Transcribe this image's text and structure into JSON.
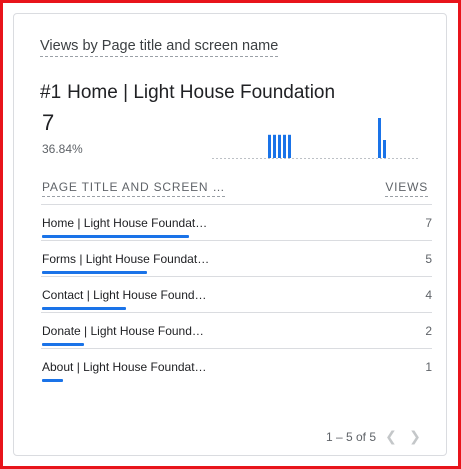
{
  "card": {
    "title": "Views by Page title and screen name"
  },
  "top": {
    "rank": "#1",
    "label": "Home | Light House Foundation",
    "value": "7",
    "percent": "36.84%"
  },
  "sparkline": {
    "bar_color": "#1a73e8",
    "baseline_color": "#bdc1c6",
    "baseline_style": "dotted",
    "groups": [
      {
        "values": [
          0.58,
          0.58,
          0.58,
          0.58,
          0.58
        ]
      },
      {
        "values": [
          1.0,
          0.45
        ]
      }
    ]
  },
  "table": {
    "headers": {
      "title": "PAGE TITLE AND SCREEN …",
      "views": "VIEWS"
    },
    "max_views": 7,
    "accent_color": "#1a73e8",
    "rows": [
      {
        "name": "Home | Light House Foundat…",
        "views": 7
      },
      {
        "name": "Forms | Light House Foundat…",
        "views": 5
      },
      {
        "name": "Contact | Light House Found…",
        "views": 4
      },
      {
        "name": "Donate | Light House Found…",
        "views": 2
      },
      {
        "name": "About | Light House Foundat…",
        "views": 1
      }
    ]
  },
  "pagination": {
    "label": "1 – 5 of 5",
    "prev_icon": "chevron-left-icon",
    "next_icon": "chevron-right-icon"
  }
}
